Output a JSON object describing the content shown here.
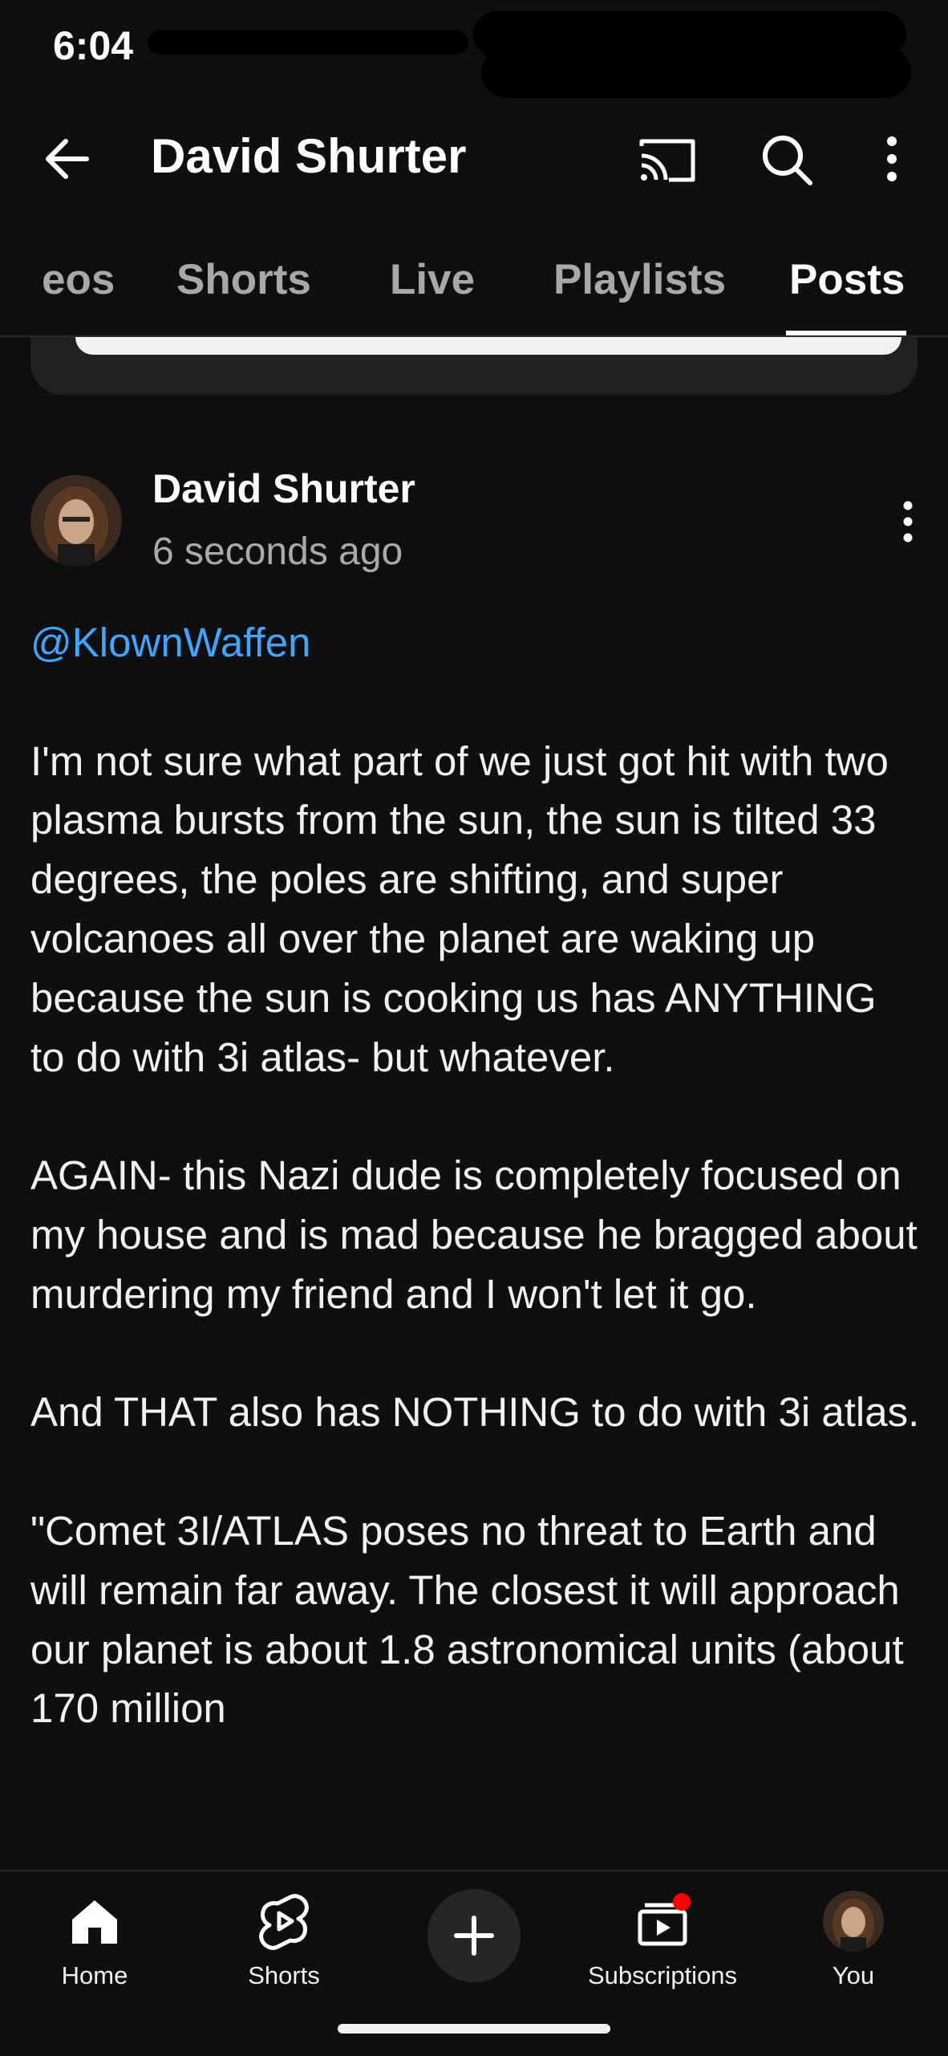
{
  "status": {
    "time": "6:04"
  },
  "header": {
    "title": "David Shurter"
  },
  "tabs": [
    {
      "label": "eos"
    },
    {
      "label": "Shorts"
    },
    {
      "label": "Live"
    },
    {
      "label": "Playlists"
    },
    {
      "label": "Posts",
      "active": true
    }
  ],
  "post": {
    "author": "David Shurter",
    "timestamp": "6 seconds ago",
    "mention": "@KlownWaffen",
    "paragraphs": [
      "I'm not sure what part of we just got hit with two plasma bursts from the sun, the sun is tilted 33 degrees, the poles are shifting, and super volcanoes all over the planet are waking up because the sun is cooking us has ANYTHING to do with 3i atlas- but whatever.",
      "AGAIN- this Nazi dude is completely focused on my house and is mad because he bragged about murdering my friend and I won't let it go.",
      "And THAT also has NOTHING to do with 3i atlas.",
      "\"Comet 3I/ATLAS poses no threat to Earth and will remain far away. The closest it will approach our planet is about 1.8 astronomical units (about 170 million"
    ]
  },
  "bottom_nav": {
    "home": "Home",
    "shorts": "Shorts",
    "subscriptions": "Subscriptions",
    "you": "You"
  },
  "colors": {
    "background": "#0f0f0f",
    "mention": "#3ea6ff",
    "notification_dot": "#ff0000"
  },
  "icons": [
    "back-arrow-icon",
    "cast-icon",
    "search-icon",
    "more-vert-icon",
    "home-icon",
    "shorts-icon",
    "plus-icon",
    "subscriptions-icon"
  ]
}
